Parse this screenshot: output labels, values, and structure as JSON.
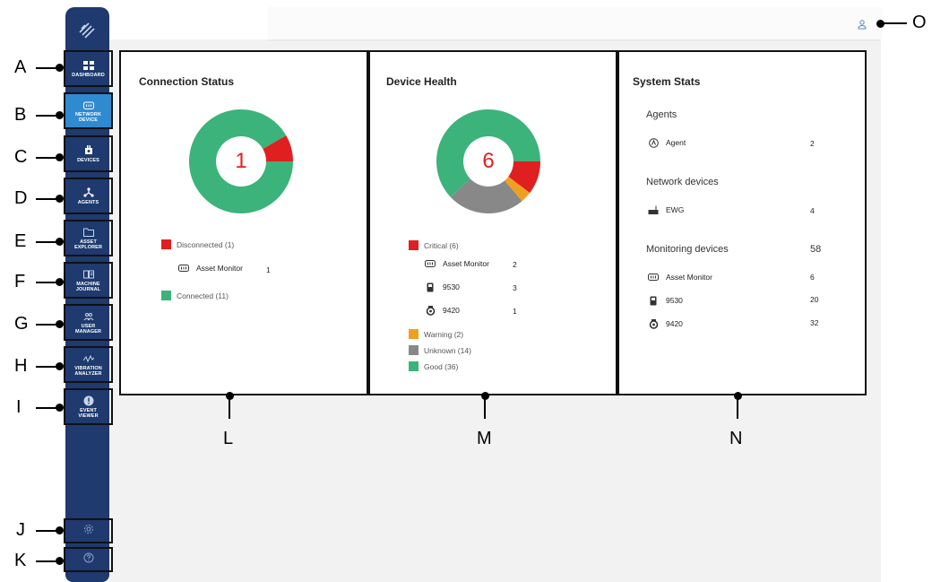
{
  "sidebar": {
    "items": [
      {
        "label": "DASHBOARD",
        "icon": "dashboard-icon",
        "active": false
      },
      {
        "label": "NETWORK\nDEVICE",
        "icon": "network-device-icon",
        "active": true
      },
      {
        "label": "DEVICES",
        "icon": "devices-icon",
        "active": false
      },
      {
        "label": "AGENTS",
        "icon": "agents-icon",
        "active": false
      },
      {
        "label": "ASSET\nEXPLORER",
        "icon": "folder-icon",
        "active": false
      },
      {
        "label": "MACHINE\nJOURNAL",
        "icon": "journal-icon",
        "active": false
      },
      {
        "label": "USER\nMANAGER",
        "icon": "users-icon",
        "active": false
      },
      {
        "label": "VIBRATION\nANALYZER",
        "icon": "vibration-icon",
        "active": false
      },
      {
        "label": "EVENT\nVIEWER",
        "icon": "alert-icon",
        "active": false
      }
    ],
    "bottom": [
      {
        "icon": "settings-icon"
      },
      {
        "icon": "help-icon"
      }
    ]
  },
  "topbar": {
    "user_icon": "user-icon"
  },
  "connection_status": {
    "title": "Connection Status",
    "center_value": "1",
    "legend": [
      {
        "label": "Disconnected (1)",
        "color": "#e02020"
      },
      {
        "label": "Connected (11)",
        "color": "#3cb37a"
      }
    ],
    "disconnected_items": [
      {
        "name": "Asset Monitor",
        "count": "1",
        "icon": "asset-monitor-icon"
      }
    ],
    "chart_data": {
      "type": "pie",
      "categories": [
        "Disconnected",
        "Connected"
      ],
      "values": [
        1,
        11
      ],
      "colors": [
        "#e02020",
        "#3cb37a"
      ]
    }
  },
  "device_health": {
    "title": "Device Health",
    "center_value": "6",
    "critical_label": "Critical (6)",
    "critical_items": [
      {
        "name": "Asset Monitor",
        "count": "2",
        "icon": "asset-monitor-icon"
      },
      {
        "name": "9530",
        "count": "3",
        "icon": "sensor-9530-icon"
      },
      {
        "name": "9420",
        "count": "1",
        "icon": "sensor-9420-icon"
      }
    ],
    "other_legend": [
      {
        "label": "Warning (2)",
        "color": "#f0a020"
      },
      {
        "label": "Unknown (14)",
        "color": "#888888"
      },
      {
        "label": "Good (36)",
        "color": "#3cb37a"
      }
    ],
    "colors": {
      "critical": "#e02020"
    },
    "chart_data": {
      "type": "pie",
      "categories": [
        "Critical",
        "Warning",
        "Unknown",
        "Good"
      ],
      "values": [
        6,
        2,
        14,
        36
      ],
      "colors": [
        "#e02020",
        "#f0a020",
        "#888888",
        "#3cb37a"
      ]
    }
  },
  "system_stats": {
    "title": "System Stats",
    "agents": {
      "heading": "Agents",
      "items": [
        {
          "name": "Agent",
          "count": "2",
          "icon": "agent-icon"
        }
      ]
    },
    "network_devices": {
      "heading": "Network devices",
      "items": [
        {
          "name": "EWG",
          "count": "4",
          "icon": "ewg-icon"
        }
      ]
    },
    "monitoring_devices": {
      "heading": "Monitoring devices",
      "total": "58",
      "items": [
        {
          "name": "Asset Monitor",
          "count": "6",
          "icon": "asset-monitor-icon"
        },
        {
          "name": "9530",
          "count": "20",
          "icon": "sensor-9530-icon"
        },
        {
          "name": "9420",
          "count": "32",
          "icon": "sensor-9420-icon"
        }
      ]
    }
  },
  "callouts": [
    "A",
    "B",
    "C",
    "D",
    "E",
    "F",
    "G",
    "H",
    "I",
    "J",
    "K",
    "L",
    "M",
    "N",
    "O"
  ]
}
